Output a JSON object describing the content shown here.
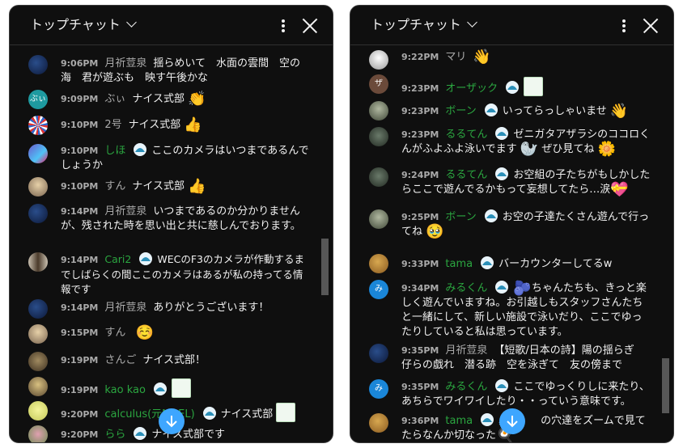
{
  "colors": {
    "panel_bg": "#0f0f0f",
    "member_name": "#2ba640",
    "text": "#f1f1f1",
    "meta": "#aaaaaa",
    "fab": "#3ea6ff"
  },
  "left": {
    "title": "トップチャット",
    "messages": [
      {
        "time": "9:06PM",
        "author": "月祈荳泉",
        "text": "揺らめいて　水面の雲間　空の海　君が遊ぶも　映す午後かな"
      },
      {
        "time": "9:09PM",
        "author": "ぶぃ",
        "avatar_text": "ぶぃ",
        "text": "ナイス式部",
        "emoji": "👏"
      },
      {
        "time": "9:10PM",
        "author": "2号",
        "text": "ナイス式部",
        "emoji": "👍"
      },
      {
        "time": "9:10PM",
        "author": "しほ",
        "text": "ここのカメラはいつまであるんでしょうか"
      },
      {
        "time": "9:10PM",
        "author": "すん",
        "text": "ナイス式部",
        "emoji": "👍"
      },
      {
        "time": "9:14PM",
        "author": "月祈荳泉",
        "text": "いつまであるのか分かりませんが、残された時を思い出と共に慈しんでおります。"
      },
      {
        "time": "9:14PM",
        "author": "Cari2",
        "text": "WECのF3のカメラが作動するまでしばらくの間ここのカメラはあるが私の持ってる情報です"
      },
      {
        "time": "9:14PM",
        "author": "月祈荳泉",
        "text": "ありがとうございます！"
      },
      {
        "time": "9:15PM",
        "author": "すん",
        "text": "",
        "emoji": "☺️"
      },
      {
        "time": "9:19PM",
        "author": "さんご",
        "text": "ナイス式部！"
      },
      {
        "time": "9:19PM",
        "author": "kao kao",
        "text": ""
      },
      {
        "time": "9:20PM",
        "author": "calculus(元NOEL)",
        "text": "ナイス式部"
      },
      {
        "time": "9:20PM",
        "author": "らら",
        "text": "ナイス式部です"
      }
    ]
  },
  "right": {
    "title": "トップチャット",
    "messages": [
      {
        "time": "9:22PM",
        "author": "マリ",
        "text": "",
        "emoji": "👋"
      },
      {
        "time": "9:23PM",
        "author": "オーザック",
        "avatar_text": "ザ",
        "text": ""
      },
      {
        "time": "9:23PM",
        "author": "ボーン",
        "text": "いってらっしゃいませ",
        "emoji": "👋"
      },
      {
        "time": "9:23PM",
        "author": "るるてん",
        "text": "ゼニガタアザラシのココロくんがふよふよ泳いでます",
        "emoji": "🦭",
        "text2": "ぜひ見てね",
        "emoji2": "🌼"
      },
      {
        "time": "9:24PM",
        "author": "るるてん",
        "text": "お空組の子たちがもしかしたらここで遊んでるかもって妄想してたら…涙",
        "emoji": "💝"
      },
      {
        "time": "9:25PM",
        "author": "ボーン",
        "text": "お空の子達たくさん遊んで行ってね",
        "emoji": "🥹"
      },
      {
        "time": "9:33PM",
        "author": "tama",
        "text": "バーカウンターしてるw"
      },
      {
        "time": "9:34PM",
        "author": "みるくん",
        "avatar_text": "み",
        "text": "",
        "emoji": "🫐",
        "text2": "ちゃんたちも、きっと楽しく遊んでいますね。お引越しもスタッフさんたちと一緒にして、新しい施設で泳いだり、ここでゆったりしていると私は思っています。"
      },
      {
        "time": "9:35PM",
        "author": "月祈荳泉",
        "text": "【短歌/日本の詩】陽の揺らぎ　仔らの戯れ　潜る跡　空を泳ぎて　友の傍まで"
      },
      {
        "time": "9:35PM",
        "author": "みるくん",
        "avatar_text": "み",
        "text": "ここでゆっくりしに来たり、あちらでワイワイしたり・・っていう意味です。"
      },
      {
        "time": "9:36PM",
        "author": "tama",
        "text": "鼻　　　の穴達をズームで見てたらなんか切なった",
        "emoji": "🍳"
      }
    ]
  }
}
